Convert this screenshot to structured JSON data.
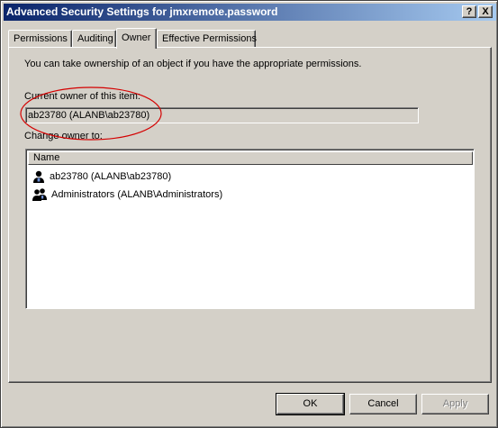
{
  "window": {
    "title": "Advanced Security Settings for jmxremote.password"
  },
  "titlebar_buttons": {
    "help": "?",
    "close": "X"
  },
  "tabs": [
    {
      "label": "Permissions"
    },
    {
      "label": "Auditing"
    },
    {
      "label": "Owner",
      "selected": true
    },
    {
      "label": "Effective Permissions"
    }
  ],
  "owner_tab": {
    "intro": "You can take ownership of an object if you have the appropriate permissions.",
    "current_owner_label": "Current owner of this item:",
    "current_owner_value": "ab23780 (ALANB\\ab23780)",
    "change_owner_label": "Change owner to:",
    "list": {
      "column_name": "Name",
      "items": [
        {
          "icon": "user-icon",
          "label": "ab23780 (ALANB\\ab23780)"
        },
        {
          "icon": "group-icon",
          "label": "Administrators (ALANB\\Administrators)"
        }
      ]
    }
  },
  "buttons": {
    "ok": "OK",
    "cancel": "Cancel",
    "apply": "Apply"
  },
  "annotation": {
    "color": "#d40000"
  },
  "colors": {
    "titlebar_start": "#0a246a",
    "titlebar_end": "#a6caf0",
    "face": "#d4d0c8"
  }
}
